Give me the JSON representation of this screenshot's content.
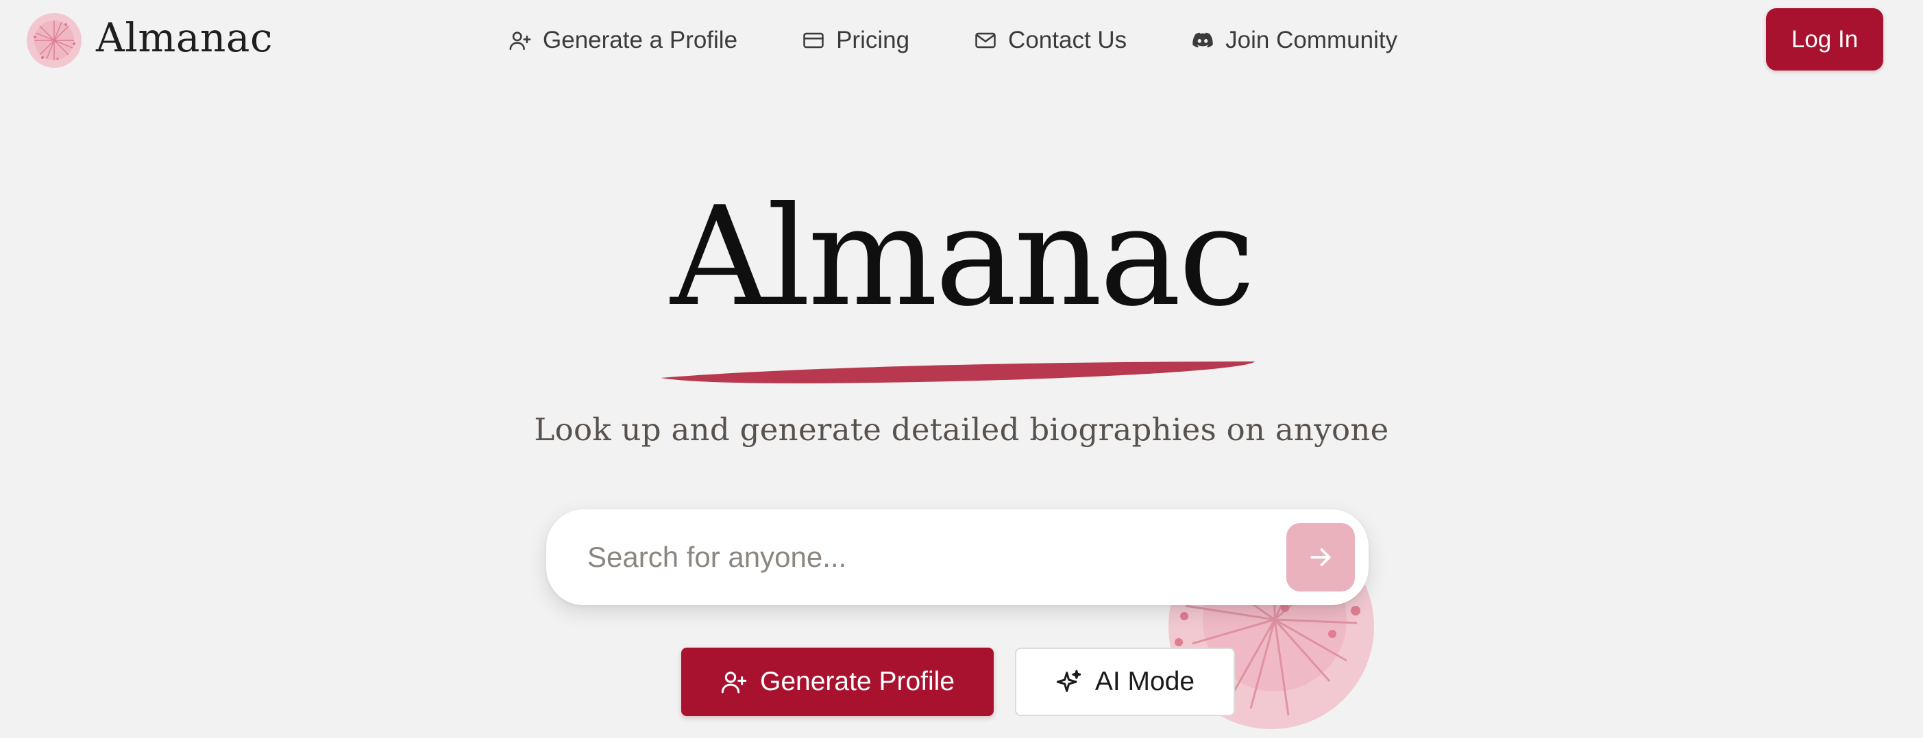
{
  "header": {
    "brand": "Almanac",
    "nav": [
      {
        "label": "Generate a Profile",
        "icon": "user-plus-icon"
      },
      {
        "label": "Pricing",
        "icon": "credit-card-icon"
      },
      {
        "label": "Contact Us",
        "icon": "mail-icon"
      },
      {
        "label": "Join Community",
        "icon": "discord-icon"
      }
    ],
    "login_label": "Log In"
  },
  "hero": {
    "title": "Almanac",
    "tagline": "Look up and generate detailed biographies on anyone"
  },
  "search": {
    "placeholder": "Search for anyone...",
    "value": "",
    "submit_icon": "arrow-right-icon"
  },
  "actions": {
    "generate_label": "Generate Profile",
    "generate_icon": "user-plus-icon",
    "ai_mode_label": "AI Mode",
    "ai_mode_icon": "sparkles-icon"
  },
  "colors": {
    "accent": "#a8122f",
    "accent_soft": "#eab2bd",
    "underline": "#b8394f",
    "background": "#f2f2f2",
    "decor_pink": "#f2c9d1"
  }
}
